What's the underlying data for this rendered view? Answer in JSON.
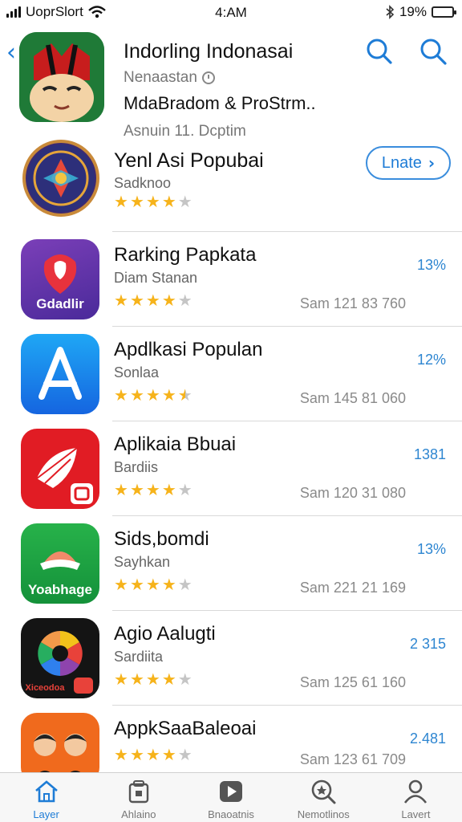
{
  "status": {
    "carrier": "UoprSlort",
    "time": "4:AM",
    "battery": "19%",
    "battery_level": 0.19
  },
  "header": {
    "title": "Indorling Indonasai",
    "subtitle": "Nenaastan",
    "line3": "MdaBradom & ProStrm..",
    "meta": "Asnuin  11. Dcptim"
  },
  "featured": {
    "title": "Yenl Asi Popubai",
    "subtitle": "Sadknoo",
    "rating": 4,
    "button": "Lnate"
  },
  "apps": [
    {
      "title": "Rarking Papkata",
      "subtitle": "Diam Stanan",
      "rating": 4,
      "size": "Sam 121 83 760",
      "badge": "13%",
      "icon_label": "Gdadlir",
      "icon": "rose-icon"
    },
    {
      "title": "Apdlkasi Populan",
      "subtitle": "Sonlaa",
      "rating": 4.5,
      "size": "Sam 145 81 060",
      "badge": "12%",
      "icon_label": "",
      "icon": "app-store-icon"
    },
    {
      "title": "Aplikaia Bbuai",
      "subtitle": "Bardiis",
      "rating": 4,
      "size": "Sam 120 31 080",
      "badge": "1381",
      "icon_label": "",
      "icon": "folded-fan-icon"
    },
    {
      "title": "Sids,bomdi",
      "subtitle": "Sayhkan",
      "rating": 4,
      "size": "Sam 221 21 169",
      "badge": "13%",
      "icon_label": "Yoabhage",
      "icon": "hat-icon"
    },
    {
      "title": "Agio Aalugti",
      "subtitle": "Sardiita",
      "rating": 4,
      "size": "Sam 125 61 160",
      "badge": "2 315",
      "icon_label": "Xiceodoa",
      "icon": "color-wheel-icon"
    },
    {
      "title": "AppkSaaBaleoai",
      "subtitle": "",
      "rating": 4,
      "size": "Sam 123 61 709",
      "badge": "2.481",
      "icon_label": "",
      "icon": "people-icon"
    }
  ],
  "tabs": [
    {
      "label": "Layer",
      "icon": "home-icon",
      "active": true
    },
    {
      "label": "Ahlaino",
      "icon": "lock-box-icon",
      "active": false
    },
    {
      "label": "Bnaoatnis",
      "icon": "play-icon",
      "active": false
    },
    {
      "label": "Nemotlinos",
      "icon": "search-star-icon",
      "active": false
    },
    {
      "label": "Lavert",
      "icon": "person-icon",
      "active": false
    }
  ]
}
